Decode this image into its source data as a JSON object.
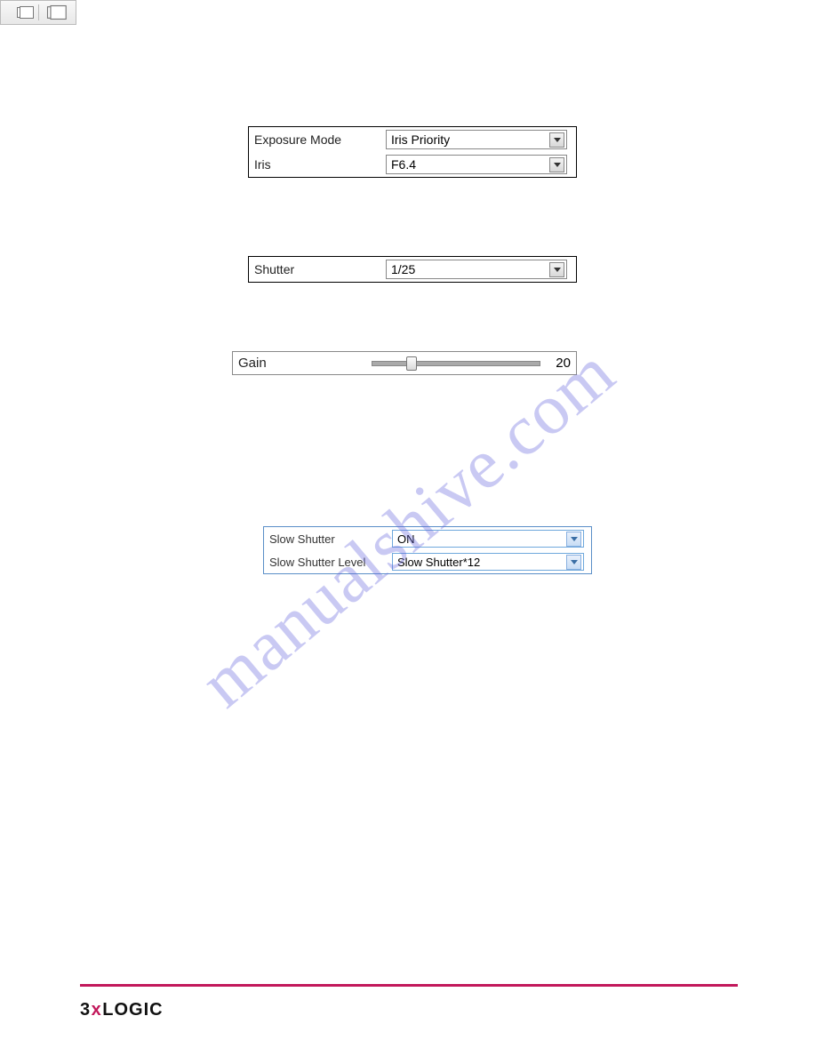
{
  "watermark": "manualshive.com",
  "exposure": {
    "mode_label": "Exposure Mode",
    "mode_value": "Iris Priority",
    "iris_label": "Iris",
    "iris_value": "F6.4"
  },
  "shutter": {
    "label": "Shutter",
    "value": "1/25"
  },
  "gain": {
    "label": "Gain",
    "value": "20"
  },
  "slow": {
    "label": "Slow Shutter",
    "value": "ON",
    "level_label": "Slow Shutter Level",
    "level_value": "Slow Shutter*12"
  },
  "footer": {
    "brand_three": "3",
    "brand_x": "x",
    "brand_logic": "LOGIC"
  }
}
